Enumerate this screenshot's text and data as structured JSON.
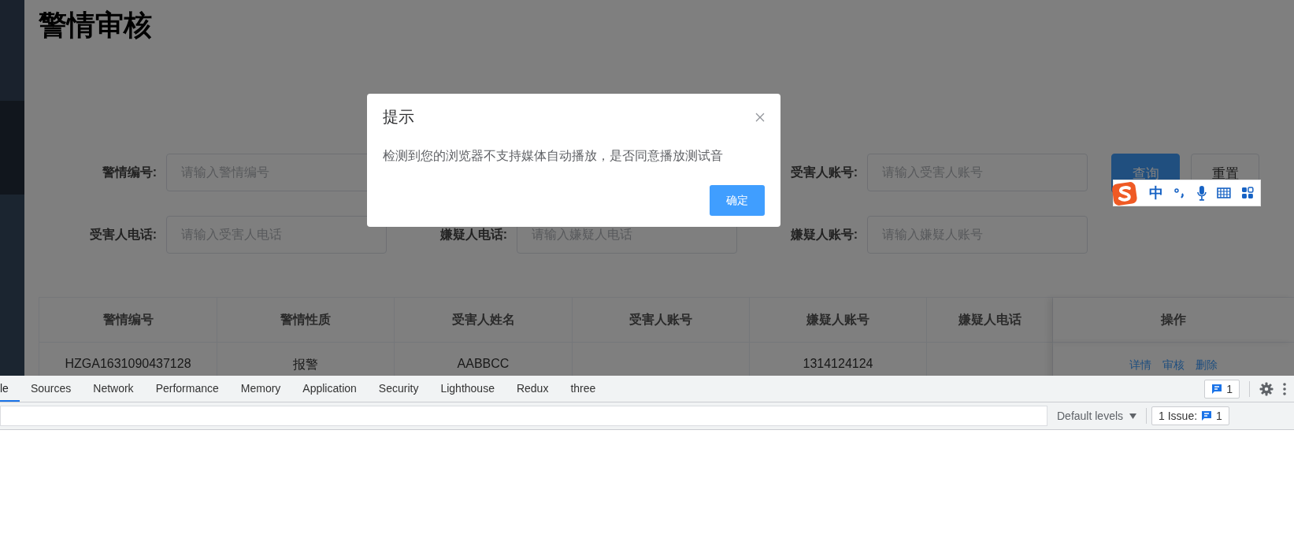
{
  "page": {
    "title": "警情审核",
    "filters": [
      {
        "label": "警情编号:",
        "placeholder": "请输入警情编号"
      },
      {
        "label": "受害人账号:",
        "placeholder": "请输入受害人账号"
      },
      {
        "label": "受害人电话:",
        "placeholder": "请输入受害人电话"
      },
      {
        "label": "嫌疑人电话:",
        "placeholder": "请输入嫌疑人电话"
      },
      {
        "label": "嫌疑人账号:",
        "placeholder": "请输入嫌疑人账号"
      }
    ],
    "buttons": [
      {
        "label": "查询",
        "kind": "primary"
      },
      {
        "label": "重置",
        "kind": "default"
      }
    ],
    "table": {
      "columns": [
        "警情编号",
        "警情性质",
        "受害人姓名",
        "受害人账号",
        "嫌疑人账号",
        "嫌疑人电话",
        "操作"
      ],
      "rows": [
        {
          "cells": [
            "HZGA1631090437128",
            "报警",
            "AABBCC",
            "",
            "1314124124",
            ""
          ],
          "actions": [
            "详情",
            "审核",
            "删除"
          ]
        }
      ]
    }
  },
  "dialog": {
    "title": "提示",
    "message": "检测到您的浏览器不支持媒体自动播放，是否同意播放测试音",
    "confirm": "确定"
  },
  "ime_toolbar": {
    "mode": "中"
  },
  "devtools": {
    "tabs": [
      {
        "label": "le",
        "selected": true
      },
      {
        "label": "Sources",
        "selected": false
      },
      {
        "label": "Network",
        "selected": false
      },
      {
        "label": "Performance",
        "selected": false
      },
      {
        "label": "Memory",
        "selected": false
      },
      {
        "label": "Application",
        "selected": false
      },
      {
        "label": "Security",
        "selected": false
      },
      {
        "label": "Lighthouse",
        "selected": false
      },
      {
        "label": "Redux",
        "selected": false
      },
      {
        "label": "three",
        "selected": false
      }
    ],
    "issues_badge": "1",
    "levels": "Default levels",
    "issues_label": "1 Issue:",
    "issues_count": "1"
  }
}
